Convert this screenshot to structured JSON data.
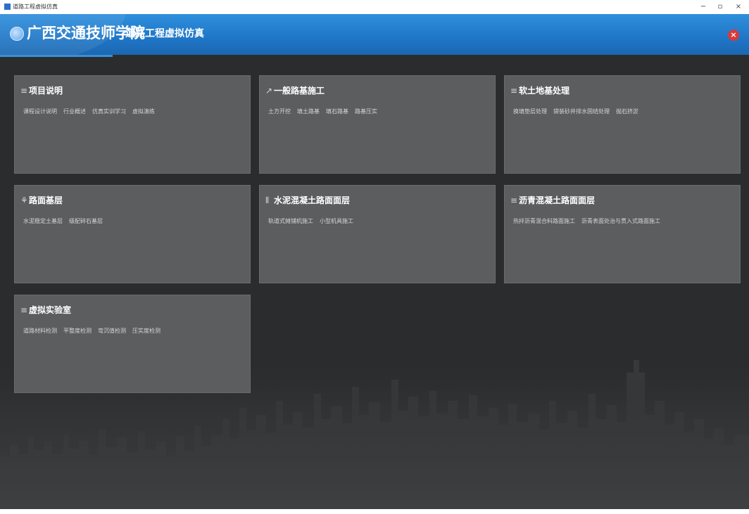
{
  "window": {
    "title": "道路工程虚拟仿真",
    "minimize": "−",
    "maximize": "▫",
    "close": "×"
  },
  "header": {
    "school": "广西交通技师学院",
    "app": "道路工程虚拟仿真",
    "close_icon": "×"
  },
  "cards": [
    {
      "icon": "≡",
      "title": "项目说明",
      "items": [
        "课程设计说明",
        "行业概述",
        "仿真实训学习",
        "虚拟演练"
      ]
    },
    {
      "icon": "↗",
      "title": "一般路基施工",
      "items": [
        "土方开挖",
        "填土路基",
        "填石路基",
        "路基压实"
      ]
    },
    {
      "icon": "≡",
      "title": "软土地基处理",
      "items": [
        "换填垫层处理",
        "袋装砂井排水固结处理",
        "抛石挤淤"
      ]
    },
    {
      "icon": "⚘",
      "title": "路面基层",
      "items": [
        "水泥稳定土基层",
        "级配碎石基层"
      ]
    },
    {
      "icon": "⦀",
      "title": "水泥混凝土路面面层",
      "items": [
        "轨道式摊铺机施工",
        "小型机具施工"
      ]
    },
    {
      "icon": "≡",
      "title": "沥青混凝土路面面层",
      "items": [
        "热拌沥青混合料路面施工",
        "沥青表面处治与贯入式路面施工"
      ]
    },
    {
      "icon": "≡",
      "title": "虚拟实验室",
      "items": [
        "道路材料检测",
        "平整度检测",
        "弯沉值检测",
        "压实度检测"
      ]
    }
  ]
}
